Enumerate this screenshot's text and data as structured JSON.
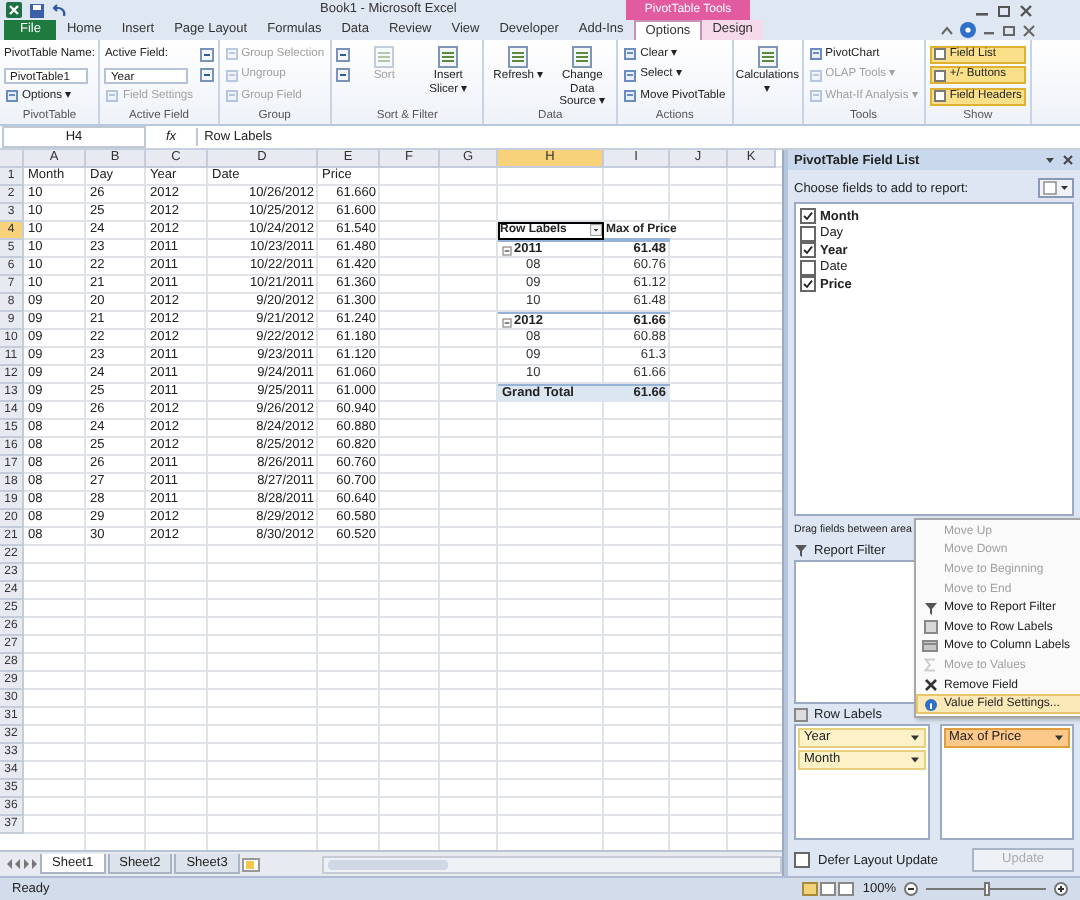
{
  "window": {
    "title": "Book1 - Microsoft Excel",
    "context_label": "PivotTable Tools"
  },
  "tabs": [
    {
      "label": "File",
      "kind": "file",
      "selected": false
    },
    {
      "label": "Home",
      "kind": "normal",
      "selected": false
    },
    {
      "label": "Insert",
      "kind": "normal",
      "selected": false
    },
    {
      "label": "Page Layout",
      "kind": "normal",
      "selected": false
    },
    {
      "label": "Formulas",
      "kind": "normal",
      "selected": false
    },
    {
      "label": "Data",
      "kind": "normal",
      "selected": false
    },
    {
      "label": "Review",
      "kind": "normal",
      "selected": false
    },
    {
      "label": "View",
      "kind": "normal",
      "selected": false
    },
    {
      "label": "Developer",
      "kind": "normal",
      "selected": false
    },
    {
      "label": "Add-Ins",
      "kind": "normal",
      "selected": false
    },
    {
      "label": "Options",
      "kind": "context",
      "selected": true
    },
    {
      "label": "Design",
      "kind": "context",
      "selected": false
    }
  ],
  "ribbon": [
    {
      "label": "PivotTable",
      "items": [
        {
          "kind": "caption",
          "text": "PivotTable Name:"
        },
        {
          "kind": "input",
          "text": "PivotTable1"
        },
        {
          "kind": "button",
          "text": "Options ▾",
          "disabled": false
        }
      ]
    },
    {
      "label": "Active Field",
      "items": [
        {
          "kind": "caption",
          "text": "Active Field:"
        },
        {
          "kind": "input",
          "text": "Year"
        },
        {
          "kind": "button",
          "text": "Field Settings",
          "disabled": true
        },
        {
          "kind": "icon_button"
        },
        {
          "kind": "icon_button"
        }
      ]
    },
    {
      "label": "Group",
      "items": [
        {
          "kind": "button",
          "text": "Group Selection",
          "disabled": true
        },
        {
          "kind": "button",
          "text": "Ungroup",
          "disabled": true
        },
        {
          "kind": "button",
          "text": "Group Field",
          "disabled": true
        }
      ]
    },
    {
      "label": "Sort & Filter",
      "items": [
        {
          "kind": "icon_button"
        },
        {
          "kind": "icon_button"
        },
        {
          "kind": "large",
          "text": "Sort",
          "disabled": true
        },
        {
          "kind": "large",
          "text": "Insert Slicer ▾",
          "disabled": false
        }
      ]
    },
    {
      "label": "Data",
      "items": [
        {
          "kind": "large",
          "text": "Refresh ▾",
          "disabled": false
        },
        {
          "kind": "large",
          "text": "Change Data Source ▾",
          "disabled": false
        }
      ]
    },
    {
      "label": "Actions",
      "items": [
        {
          "kind": "button",
          "text": "Clear ▾",
          "disabled": false
        },
        {
          "kind": "button",
          "text": "Select ▾",
          "disabled": false
        },
        {
          "kind": "button",
          "text": "Move PivotTable",
          "disabled": false
        }
      ]
    },
    {
      "items": [
        {
          "kind": "large",
          "text": "Calculations ▾",
          "disabled": false
        }
      ]
    },
    {
      "label": "Tools",
      "items": [
        {
          "kind": "button",
          "text": "PivotChart",
          "disabled": false
        },
        {
          "kind": "button",
          "text": "OLAP Tools ▾",
          "disabled": true
        },
        {
          "kind": "button",
          "text": "What-If Analysis ▾",
          "disabled": true
        }
      ]
    },
    {
      "label": "Show",
      "items": [
        {
          "kind": "toggle",
          "text": "Field List",
          "on": true
        },
        {
          "kind": "toggle",
          "text": "+/- Buttons",
          "on": true
        },
        {
          "kind": "toggle",
          "text": "Field Headers",
          "on": true
        }
      ]
    }
  ],
  "formula_bar": {
    "name_box": "H4",
    "function_label": "fx",
    "value": "Row Labels"
  },
  "sheet": {
    "columns": [
      {
        "label": "A",
        "selected": false
      },
      {
        "label": "B",
        "selected": false
      },
      {
        "label": "C",
        "selected": false
      },
      {
        "label": "D",
        "selected": false
      },
      {
        "label": "E",
        "selected": false
      },
      {
        "label": "F",
        "selected": false
      },
      {
        "label": "G",
        "selected": false
      },
      {
        "label": "H",
        "selected": true
      },
      {
        "label": "I",
        "selected": false
      },
      {
        "label": "J",
        "selected": false
      },
      {
        "label": "K",
        "selected": false
      }
    ],
    "rows": [
      {
        "number": "1",
        "selected": false,
        "cells": [
          "Month",
          "Day",
          "Year",
          "Date",
          "Price"
        ]
      },
      {
        "number": "2",
        "selected": false,
        "cells": [
          "10",
          "26",
          "2012",
          "10/26/2012",
          "61.660"
        ]
      },
      {
        "number": "3",
        "selected": false,
        "cells": [
          "10",
          "25",
          "2012",
          "10/25/2012",
          "61.600"
        ]
      },
      {
        "number": "4",
        "selected": true,
        "cells": [
          "10",
          "24",
          "2012",
          "10/24/2012",
          "61.540"
        ],
        "pivot": {
          "kind": "header",
          "label": "Row Labels",
          "value": "Max of Price"
        }
      },
      {
        "number": "5",
        "selected": false,
        "cells": [
          "10",
          "23",
          "2011",
          "10/23/2011",
          "61.480"
        ],
        "pivot": {
          "kind": "group",
          "label": "2011",
          "value": "61.48",
          "expanded": true
        }
      },
      {
        "number": "6",
        "selected": false,
        "cells": [
          "10",
          "22",
          "2011",
          "10/22/2011",
          "61.420"
        ],
        "pivot": {
          "kind": "item",
          "label": "08",
          "value": "60.76"
        }
      },
      {
        "number": "7",
        "selected": false,
        "cells": [
          "10",
          "21",
          "2011",
          "10/21/2011",
          "61.360"
        ],
        "pivot": {
          "kind": "item",
          "label": "09",
          "value": "61.12"
        }
      },
      {
        "number": "8",
        "selected": false,
        "cells": [
          "09",
          "20",
          "2012",
          "9/20/2012",
          "61.300"
        ],
        "pivot": {
          "kind": "item",
          "label": "10",
          "value": "61.48"
        }
      },
      {
        "number": "9",
        "selected": false,
        "cells": [
          "09",
          "21",
          "2012",
          "9/21/2012",
          "61.240"
        ],
        "pivot": {
          "kind": "group",
          "label": "2012",
          "value": "61.66",
          "expanded": true
        }
      },
      {
        "number": "10",
        "selected": false,
        "cells": [
          "09",
          "22",
          "2012",
          "9/22/2012",
          "61.180"
        ],
        "pivot": {
          "kind": "item",
          "label": "08",
          "value": "60.88"
        }
      },
      {
        "number": "11",
        "selected": false,
        "cells": [
          "09",
          "23",
          "2011",
          "9/23/2011",
          "61.120"
        ],
        "pivot": {
          "kind": "item",
          "label": "09",
          "value": "61.3"
        }
      },
      {
        "number": "12",
        "selected": false,
        "cells": [
          "09",
          "24",
          "2011",
          "9/24/2011",
          "61.060"
        ],
        "pivot": {
          "kind": "item",
          "label": "10",
          "value": "61.66"
        }
      },
      {
        "number": "13",
        "selected": false,
        "cells": [
          "09",
          "25",
          "2011",
          "9/25/2011",
          "61.000"
        ],
        "pivot": {
          "kind": "total",
          "label": "Grand Total",
          "value": "61.66"
        }
      },
      {
        "number": "14",
        "selected": false,
        "cells": [
          "09",
          "26",
          "2012",
          "9/26/2012",
          "60.940"
        ]
      },
      {
        "number": "15",
        "selected": false,
        "cells": [
          "08",
          "24",
          "2012",
          "8/24/2012",
          "60.880"
        ]
      },
      {
        "number": "16",
        "selected": false,
        "cells": [
          "08",
          "25",
          "2012",
          "8/25/2012",
          "60.820"
        ]
      },
      {
        "number": "17",
        "selected": false,
        "cells": [
          "08",
          "26",
          "2011",
          "8/26/2011",
          "60.760"
        ]
      },
      {
        "number": "18",
        "selected": false,
        "cells": [
          "08",
          "27",
          "2011",
          "8/27/2011",
          "60.700"
        ]
      },
      {
        "number": "19",
        "selected": false,
        "cells": [
          "08",
          "28",
          "2011",
          "8/28/2011",
          "60.640"
        ]
      },
      {
        "number": "20",
        "selected": false,
        "cells": [
          "08",
          "29",
          "2012",
          "8/29/2012",
          "60.580"
        ]
      },
      {
        "number": "21",
        "selected": false,
        "cells": [
          "08",
          "30",
          "2012",
          "8/30/2012",
          "60.520"
        ]
      },
      {
        "number": "22",
        "selected": false
      },
      {
        "number": "23",
        "selected": false
      },
      {
        "number": "24",
        "selected": false
      },
      {
        "number": "25",
        "selected": false
      },
      {
        "number": "26",
        "selected": false
      },
      {
        "number": "27",
        "selected": false
      },
      {
        "number": "28",
        "selected": false
      },
      {
        "number": "29",
        "selected": false
      },
      {
        "number": "30",
        "selected": false
      },
      {
        "number": "31",
        "selected": false
      },
      {
        "number": "32",
        "selected": false
      },
      {
        "number": "33",
        "selected": false
      },
      {
        "number": "34",
        "selected": false
      },
      {
        "number": "35",
        "selected": false
      },
      {
        "number": "36",
        "selected": false
      },
      {
        "number": "37",
        "selected": false
      }
    ],
    "sheet_tabs": [
      {
        "label": "Sheet1",
        "selected": true
      },
      {
        "label": "Sheet2",
        "selected": false
      },
      {
        "label": "Sheet3",
        "selected": false
      }
    ]
  },
  "field_list": {
    "title": "PivotTable Field List",
    "prompt": "Choose fields to add to report:",
    "fields": [
      {
        "label": "Month",
        "checked": true
      },
      {
        "label": "Day",
        "checked": false
      },
      {
        "label": "Year",
        "checked": true
      },
      {
        "label": "Date",
        "checked": false
      },
      {
        "label": "Price",
        "checked": true
      }
    ],
    "areas_prompt": "Drag fields between area",
    "areas": [
      {
        "kind": "filter",
        "label": "Report Filter"
      },
      {
        "kind": "rows",
        "label": "Row Labels",
        "fields": [
          {
            "label": "Year",
            "selected": false
          },
          {
            "label": "Month",
            "selected": false
          }
        ]
      },
      {
        "kind": "values",
        "fields": [
          {
            "label": "Max of Price",
            "selected": true
          }
        ]
      }
    ],
    "defer": {
      "label": "Defer Layout Update",
      "checked": false
    },
    "update_button": {
      "label": "Update",
      "disabled": true
    }
  },
  "menu": [
    {
      "kind": "plain",
      "label": "Move Up",
      "disabled": true,
      "selected": false
    },
    {
      "kind": "plain",
      "label": "Move Down",
      "disabled": true,
      "selected": false
    },
    {
      "kind": "plain",
      "label": "Move to Beginning",
      "disabled": true,
      "selected": false
    },
    {
      "kind": "plain",
      "label": "Move to End",
      "disabled": true,
      "selected": false
    },
    {
      "kind": "filter",
      "label": "Move to Report Filter",
      "disabled": false,
      "selected": false
    },
    {
      "kind": "rows",
      "label": "Move to Row Labels",
      "disabled": false,
      "selected": false
    },
    {
      "kind": "columns",
      "label": "Move to Column Labels",
      "disabled": false,
      "selected": false
    },
    {
      "kind": "sum",
      "label": "Move to Values",
      "disabled": true,
      "selected": false
    },
    {
      "kind": "remove",
      "label": "Remove Field",
      "disabled": false,
      "selected": false
    },
    {
      "kind": "settings",
      "label": "Value Field Settings...",
      "disabled": false,
      "selected": true
    }
  ],
  "status_bar": {
    "label": "Ready",
    "zoom": {
      "label": "100%",
      "level": 0.5
    }
  }
}
